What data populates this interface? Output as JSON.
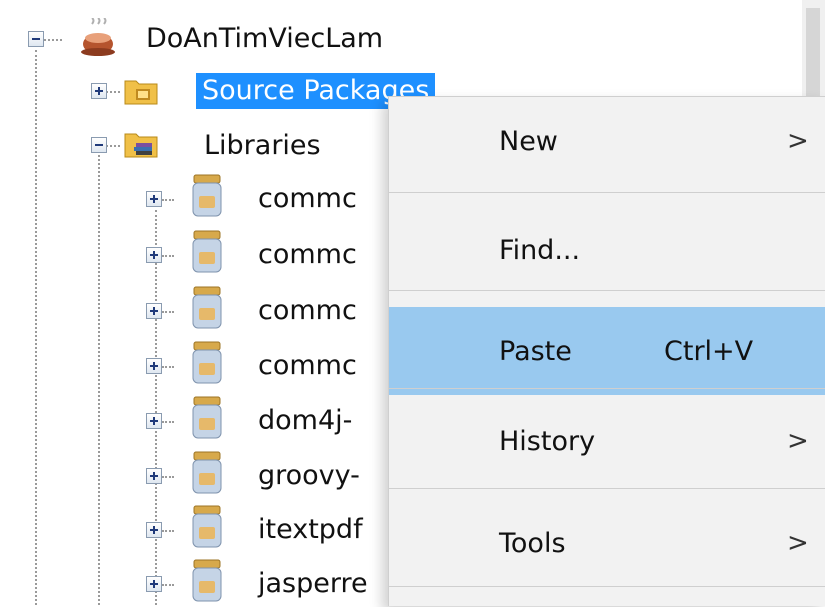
{
  "tree": {
    "project": {
      "label": "DoAnTimViecLam",
      "icon": "coffee-cup-icon",
      "expanded": true
    },
    "source_packages": {
      "label": "Source Packages",
      "icon": "package-folder-icon",
      "selected": true
    },
    "libraries": {
      "label": "Libraries",
      "icon": "library-folder-icon",
      "expanded": true
    },
    "jars": [
      {
        "label": "commc",
        "icon": "jar-icon"
      },
      {
        "label": "commc",
        "icon": "jar-icon"
      },
      {
        "label": "commc",
        "icon": "jar-icon"
      },
      {
        "label": "commc",
        "icon": "jar-icon"
      },
      {
        "label": "dom4j-",
        "icon": "jar-icon"
      },
      {
        "label": "groovy-",
        "icon": "jar-icon"
      },
      {
        "label": "itextpdf",
        "icon": "jar-icon"
      },
      {
        "label": "jasperre",
        "icon": "jar-icon"
      }
    ]
  },
  "context_menu": {
    "items": [
      {
        "label": "New",
        "shortcut": "",
        "has_submenu": true,
        "highlighted": false
      },
      {
        "label": "Find...",
        "shortcut": "",
        "has_submenu": false,
        "highlighted": false
      },
      {
        "label": "Paste",
        "shortcut": "Ctrl+V",
        "has_submenu": false,
        "highlighted": true
      },
      {
        "label": "History",
        "shortcut": "",
        "has_submenu": true,
        "highlighted": false
      },
      {
        "label": "Tools",
        "shortcut": "",
        "has_submenu": true,
        "highlighted": false
      }
    ],
    "submenu_glyph": ">"
  },
  "colors": {
    "selection": "#1e90ff",
    "menu_highlight": "#99c9ef",
    "menu_background": "#f2f2f2"
  }
}
